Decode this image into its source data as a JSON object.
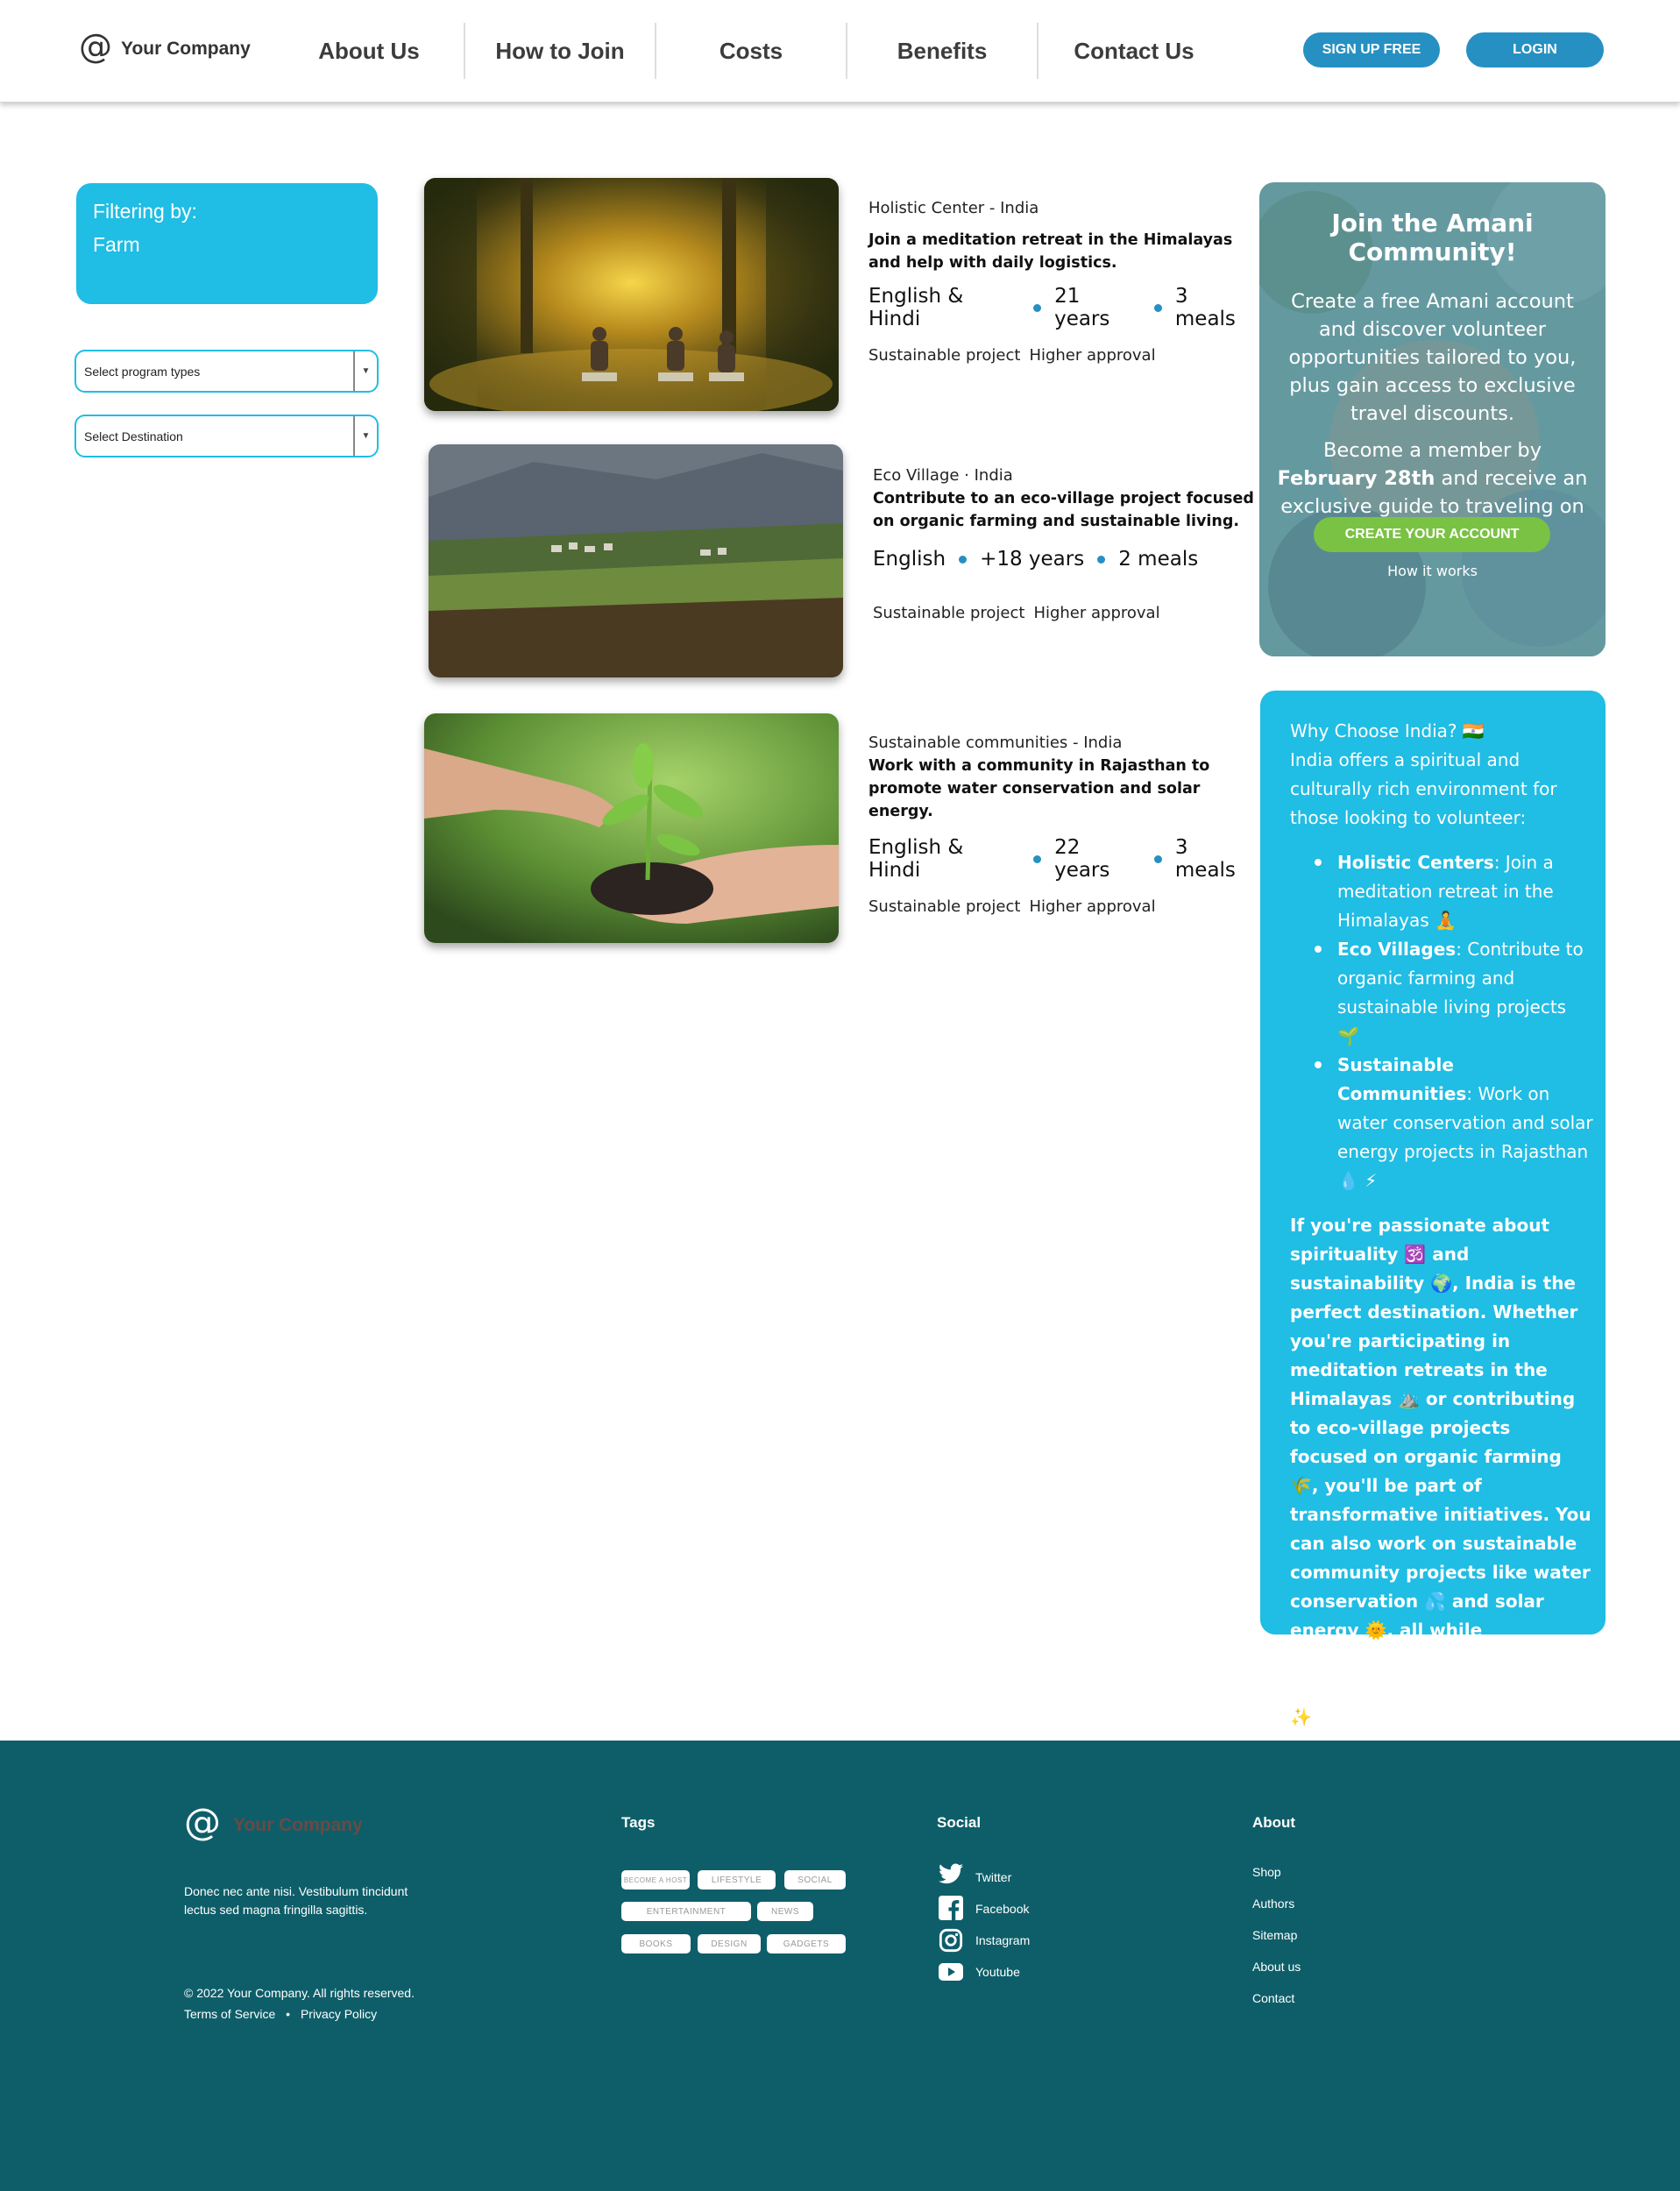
{
  "header": {
    "logo_symbol": "@",
    "company": "Your Company",
    "nav": [
      "About Us",
      "How to Join",
      "Costs",
      "Benefits",
      "Contact Us"
    ],
    "signup": "SIGN UP FREE",
    "login": "LOGIN"
  },
  "sidebar": {
    "filter_title": "Filtering by:",
    "filter_value": "Farm",
    "select_program": "Select program types",
    "select_destination": "Select Destination"
  },
  "listings": [
    {
      "category": "Holistic Center - India",
      "description": "Join a meditation retreat in the Himalayas and help with daily logistics.",
      "language": "English & Hindi",
      "age": "21 years",
      "meals": "3 meals",
      "tag1": "Sustainable project",
      "tag2": "Higher approval"
    },
    {
      "category": "Eco Village · India",
      "description": "Contribute to an eco-village project focused on organic farming and sustainable living.",
      "language": "English",
      "age": "+18 years",
      "meals": "2 meals",
      "tag1": "Sustainable project",
      "tag2": "Higher approval"
    },
    {
      "category": "Sustainable communities - India",
      "description": "Work with a community in Rajasthan to promote water conservation and solar energy.",
      "language": "English & Hindi",
      "age": "22 years",
      "meals": "3 meals",
      "tag1": "Sustainable project",
      "tag2": "Higher approval"
    }
  ],
  "join": {
    "title": "Join the Amani Community!",
    "p1": "Create a free Amani account and discover volunteer opportunities tailored to you, plus gain access to exclusive travel discounts.",
    "p2_start": "Become a member by ",
    "p2_bold": "February 28th",
    "p2_end": " and receive an exclusive guide to traveling on a budget.",
    "cta": "CREATE YOUR ACCOUNT",
    "how": "How it works"
  },
  "why": {
    "title": "Why Choose India? 🇮🇳",
    "intro": "India offers a spiritual and culturally rich environment for those looking to volunteer:",
    "items": [
      {
        "bold": "Holistic Centers",
        "text": ": Join a meditation retreat in the Himalayas 🧘"
      },
      {
        "bold": "Eco Villages",
        "text": ": Contribute to organic farming and sustainable living projects 🌱"
      },
      {
        "bold": "Sustainable Communities",
        "text": ": Work on water conservation and solar energy projects in Rajasthan 💧 ⚡"
      }
    ],
    "closing": "If you're passionate about spirituality 🕉️ and sustainability 🌍, India is the perfect destination. Whether you're participating in meditation retreats in the Himalayas ⛰️ or contributing to eco-village projects focused on organic farming 🌾, you'll be part of transformative initiatives. You can also work on sustainable community projects like water conservation 💦 and solar energy 🌞, all while experiencing India's deep cultural and spiritual heritage ✨."
  },
  "footer": {
    "logo_symbol": "@",
    "company": "Your Company",
    "text": "Donec nec ante nisi. Vestibulum tincidunt lectus sed magna fringilla sagittis.",
    "copyright": "© 2022 Your Company.  All rights reserved.",
    "terms": "Terms of Service",
    "separator": "•",
    "privacy": "Privacy Policy",
    "tags_title": "Tags",
    "tags": [
      "BECOME A HOST",
      "LIFESTYLE",
      "SOCIAL",
      "ENTERTAINMENT",
      "NEWS",
      "BOOKS",
      "DESIGN",
      "GADGETS"
    ],
    "social_title": "Social",
    "social": [
      "Twitter",
      "Facebook",
      "Instagram",
      "Youtube"
    ],
    "about_title": "About",
    "about": [
      "Shop",
      "Authors",
      "Sitemap",
      "About us",
      "Contact"
    ]
  },
  "colors": {
    "accent": "#20bde4",
    "button": "#2690c2",
    "cta_green": "#7ac243",
    "footer_bg": "#0e5e69"
  }
}
